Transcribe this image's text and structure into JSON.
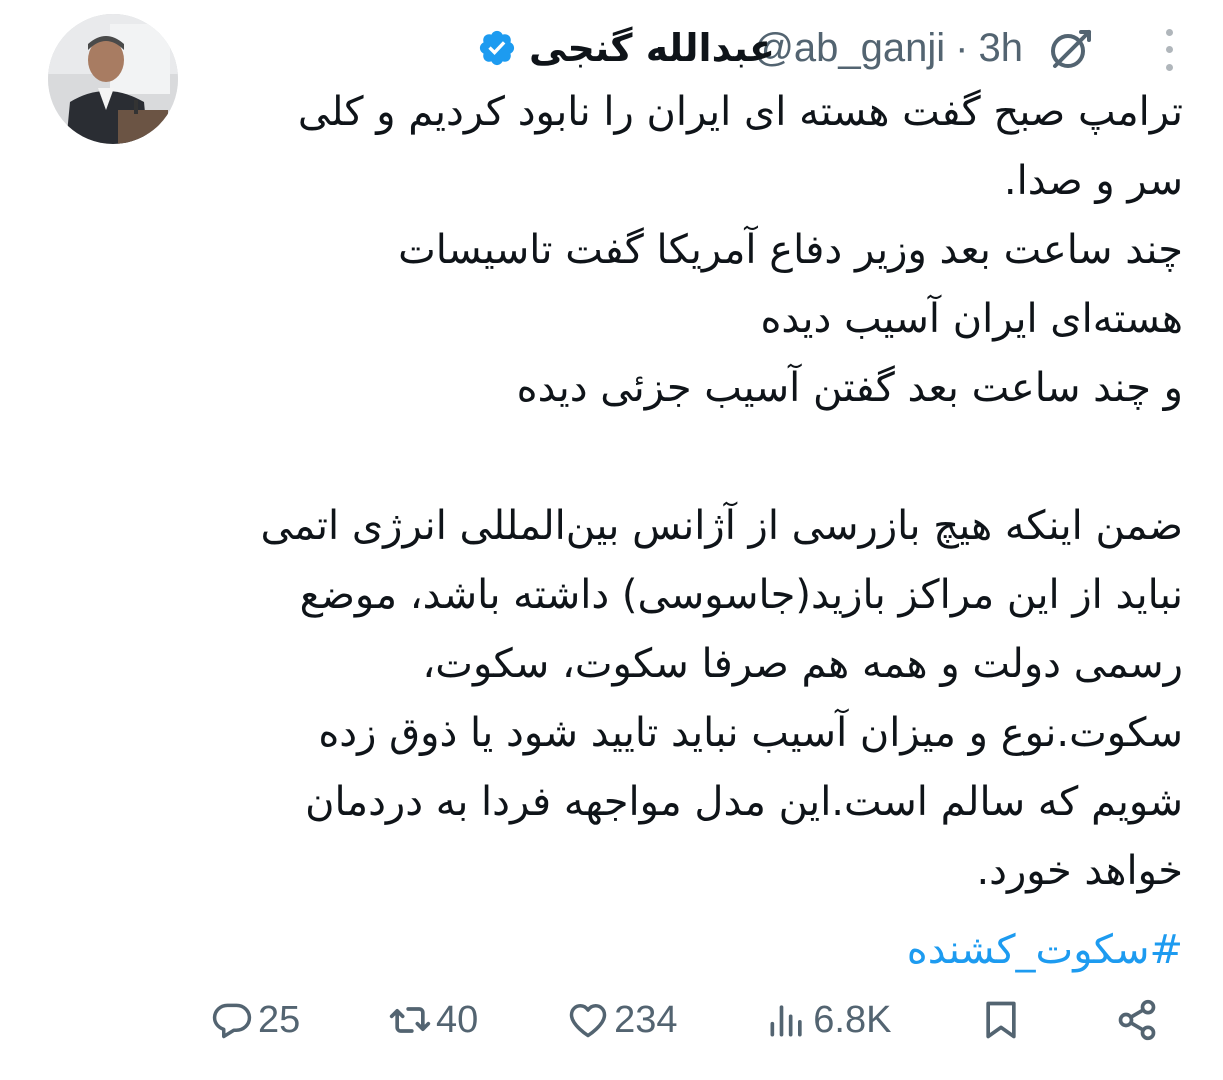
{
  "tweet": {
    "author": {
      "name": "عبدالله گنجی",
      "handle": "@ab_ganji",
      "separator": "·",
      "time": "3h"
    },
    "body": {
      "lines": [
        "ترامپ صبح گفت هسته ای ایران را نابود کردیم و کلی",
        "سر و صدا.",
        "چند ساعت بعد وزیر دفاع آمریکا گفت تاسیسات",
        "هسته‌ای ایران آسیب دیده",
        "و چند ساعت بعد گفتن آسیب جزئی دیده",
        "",
        "ضمن اینکه هیچ بازرسی از آژانس بین‌المللی انرژی اتمی",
        "نباید از این مراکز بازید(جاسوسی) داشته باشد، موضع",
        "رسمی دولت و همه هم صرفا سکوت، سکوت،",
        "سکوت.نوع و میزان آسیب  نباید تایید شود یا ذوق زده",
        "شویم که سالم است.این مدل مواجهه فردا به دردمان",
        "خواهد خورد."
      ],
      "hashtag": "#سکوت_کشنده"
    },
    "actions": {
      "replies": "25",
      "reposts": "40",
      "likes": "234",
      "views": "6.8K"
    }
  },
  "colors": {
    "accent": "#1d9bf0",
    "muted": "#536471",
    "text": "#0f1419"
  },
  "icons": {
    "grok": "grok-icon",
    "more": "more-icon",
    "verified": "verified-badge-icon",
    "reply": "reply-icon",
    "repost": "repost-icon",
    "like": "heart-icon",
    "views": "views-chart-icon",
    "bookmark": "bookmark-icon",
    "share": "share-icon"
  }
}
